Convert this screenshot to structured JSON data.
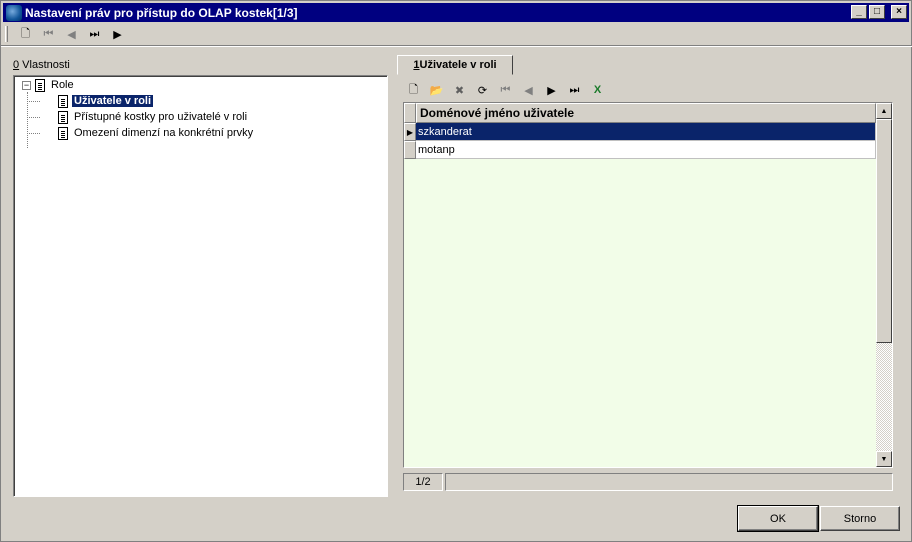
{
  "window": {
    "title": "Nastavení práv pro přístup do OLAP kostek[1/3]",
    "controls": {
      "minimize": "_",
      "maximize": "□",
      "close": "×"
    }
  },
  "top_toolbar": {
    "buttons": [
      {
        "icon": "new-document-icon",
        "glyph": "🗋",
        "enabled": true
      },
      {
        "icon": "first-record-icon",
        "glyph": "⏮",
        "enabled": false
      },
      {
        "icon": "previous-record-icon",
        "glyph": "◀",
        "enabled": false
      },
      {
        "icon": "last-record-icon",
        "glyph": "⏭",
        "enabled": true
      },
      {
        "icon": "next-record-icon",
        "glyph": "▶",
        "enabled": true
      }
    ]
  },
  "left_panel": {
    "label_key": "0",
    "label_text": " Vlastnosti",
    "tree": {
      "root": {
        "label": "Role",
        "expander": "−"
      },
      "children": [
        {
          "label": "Uživatele v roli",
          "selected": true
        },
        {
          "label": "Přístupné kostky pro uživatelé v roli",
          "selected": false
        },
        {
          "label": "Omezení dimenzí na konkrétní prvky",
          "selected": false
        }
      ]
    }
  },
  "right_panel": {
    "tab": {
      "key": "1",
      "label": " Uživatele v roli"
    },
    "toolbar": {
      "buttons": [
        {
          "icon": "new-record-icon",
          "glyph": "🗋",
          "enabled": true
        },
        {
          "icon": "open-folder-icon",
          "glyph": "📂",
          "enabled": true
        },
        {
          "icon": "delete-icon",
          "glyph": "✖",
          "enabled": true
        },
        {
          "icon": "refresh-icon",
          "glyph": "⟳",
          "enabled": true
        },
        {
          "icon": "first-record-icon",
          "glyph": "⏮",
          "enabled": false
        },
        {
          "icon": "previous-record-icon",
          "glyph": "◀",
          "enabled": false
        },
        {
          "icon": "next-record-icon",
          "glyph": "▶",
          "enabled": true
        },
        {
          "icon": "last-record-icon",
          "glyph": "⏭",
          "enabled": true
        },
        {
          "icon": "excel-export-icon",
          "glyph": "X",
          "enabled": true
        }
      ]
    },
    "grid": {
      "columns": [
        "Doménové jméno uživatele"
      ],
      "rows": [
        {
          "value": "szkanderat",
          "selected": true,
          "indicator": "▶"
        },
        {
          "value": "motanp",
          "selected": false,
          "indicator": ""
        }
      ]
    },
    "status": {
      "record_position": "1/2"
    }
  },
  "buttons": {
    "ok": "OK",
    "cancel": "Storno"
  },
  "colors": {
    "title_bar": "#000080",
    "selection": "#0a246a",
    "grid_background": "#f2fde8",
    "face": "#d4d0c8"
  }
}
